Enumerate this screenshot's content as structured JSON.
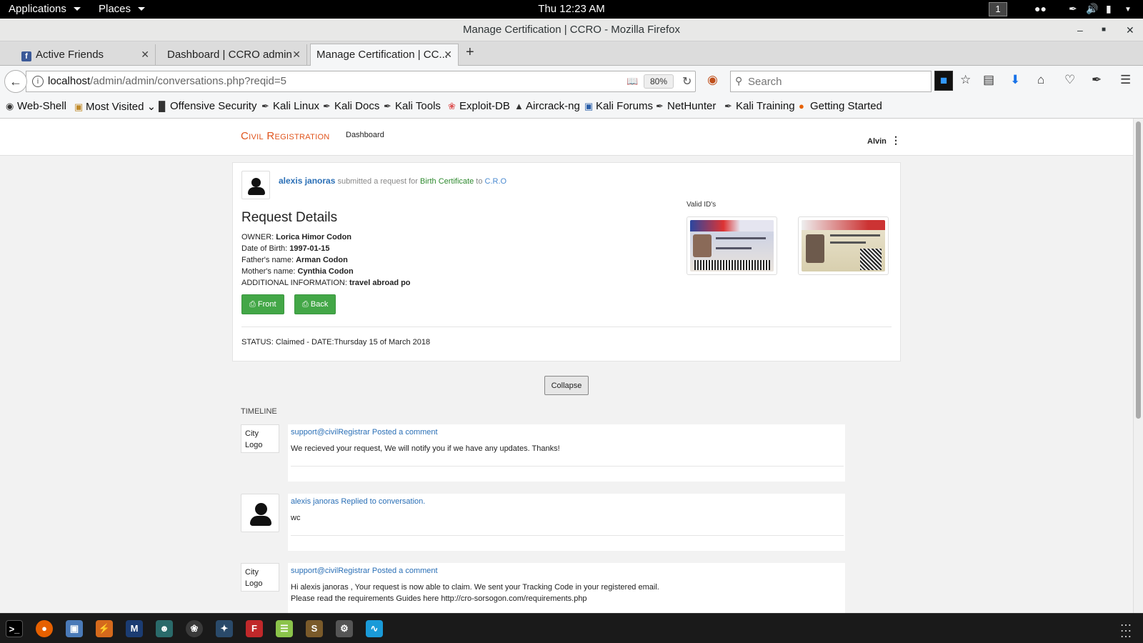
{
  "topbar": {
    "applications": "Applications",
    "places": "Places",
    "clock": "Thu 12:23 AM",
    "workspace": "1"
  },
  "window": {
    "title": "Manage Certification | CCRO - Mozilla Firefox"
  },
  "tabs": [
    {
      "label": "Active Friends"
    },
    {
      "label": "Dashboard | CCRO admin"
    },
    {
      "label": "Manage Certification | CC..."
    }
  ],
  "url": {
    "host": "localhost",
    "path": "/admin/admin/conversations.php?reqid=5",
    "zoom": "80%"
  },
  "search": {
    "placeholder": "Search"
  },
  "bookmarks": [
    {
      "label": "Web-Shell"
    },
    {
      "label": "Most Visited"
    },
    {
      "label": "Offensive Security"
    },
    {
      "label": "Kali Linux"
    },
    {
      "label": "Kali Docs"
    },
    {
      "label": "Kali Tools"
    },
    {
      "label": "Exploit-DB"
    },
    {
      "label": "Aircrack-ng"
    },
    {
      "label": "Kali Forums"
    },
    {
      "label": "NetHunter"
    },
    {
      "label": "Kali Training"
    },
    {
      "label": "Getting Started"
    }
  ],
  "app": {
    "brand": "Civil Registration",
    "nav_dashboard": "Dashboard",
    "user": "Alvin"
  },
  "request": {
    "requester": "alexis janoras",
    "submitted_text": " submitted a request for ",
    "certificate": "Birth Certificate",
    "to_text": " to ",
    "office": "C.R.O",
    "title": "Request Details",
    "valid_ids_label": "Valid ID's",
    "fields": [
      {
        "label": "OWNER: ",
        "value": "Lorica Himor Codon"
      },
      {
        "label": "Date of Birth: ",
        "value": "1997-01-15"
      },
      {
        "label": "Father's name: ",
        "value": "Arman Codon"
      },
      {
        "label": "Mother's name: ",
        "value": "Cynthia Codon"
      },
      {
        "label": "ADDITIONAL INFORMATION: ",
        "value": "travel abroad po"
      }
    ],
    "front_button": "Front",
    "back_button": "Back",
    "status": "STATUS: Claimed - DATE:Thursday 15 of March 2018",
    "collapse_button": "Collapse"
  },
  "timeline": {
    "label": "TIMELINE",
    "logo_text": "City Logo",
    "items": [
      {
        "author": "support@civilRegistrar",
        "action": " Posted a comment",
        "message": "We recieved your request, We will notify you if we have any updates. Thanks!"
      },
      {
        "author": "alexis janoras",
        "action": " Replied to conversation.",
        "message": "wc"
      },
      {
        "author": "support@civilRegistrar",
        "action": " Posted a comment",
        "message": "Hi alexis janoras , Your request is now able to claim. We sent your Tracking Code in your registered email.",
        "message2": "Please read the requirements Guides here http://cro-sorsogon.com/requirements.php"
      }
    ]
  },
  "colors": {
    "brand": "#e0541c",
    "link": "#2a6fb6",
    "success": "#43a747"
  }
}
